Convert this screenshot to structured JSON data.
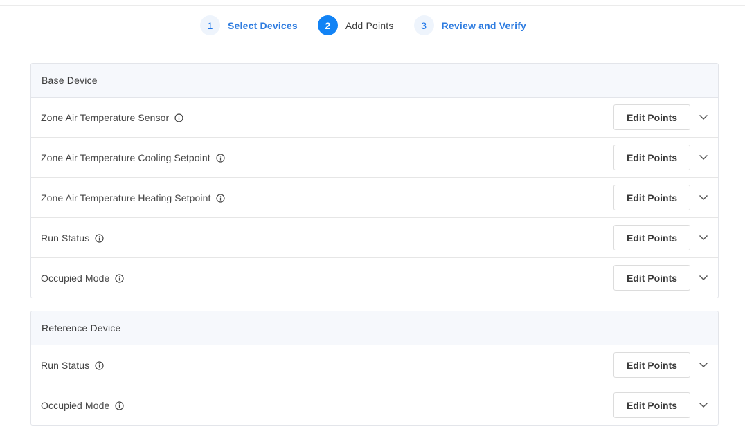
{
  "stepper": {
    "steps": [
      {
        "num": "1",
        "label": "Select Devices",
        "state": "complete"
      },
      {
        "num": "2",
        "label": "Add Points",
        "state": "active"
      },
      {
        "num": "3",
        "label": "Review and Verify",
        "state": "pending"
      }
    ]
  },
  "base_device": {
    "title": "Base Device",
    "rows": [
      {
        "label": "Zone Air Temperature Sensor",
        "button": "Edit Points"
      },
      {
        "label": "Zone Air Temperature Cooling Setpoint",
        "button": "Edit Points"
      },
      {
        "label": "Zone Air Temperature Heating Setpoint",
        "button": "Edit Points"
      },
      {
        "label": "Run Status",
        "button": "Edit Points"
      },
      {
        "label": "Occupied Mode",
        "button": "Edit Points"
      }
    ]
  },
  "reference_device": {
    "title": "Reference Device",
    "rows": [
      {
        "label": "Run Status",
        "button": "Edit Points"
      },
      {
        "label": "Occupied Mode",
        "button": "Edit Points"
      }
    ]
  },
  "colors": {
    "accent": "#1283f5",
    "link": "#2e7ce0",
    "header_bg": "#f6f8fc"
  },
  "icons": {
    "info": "info-circle-icon",
    "expand": "chevron-down-icon"
  }
}
